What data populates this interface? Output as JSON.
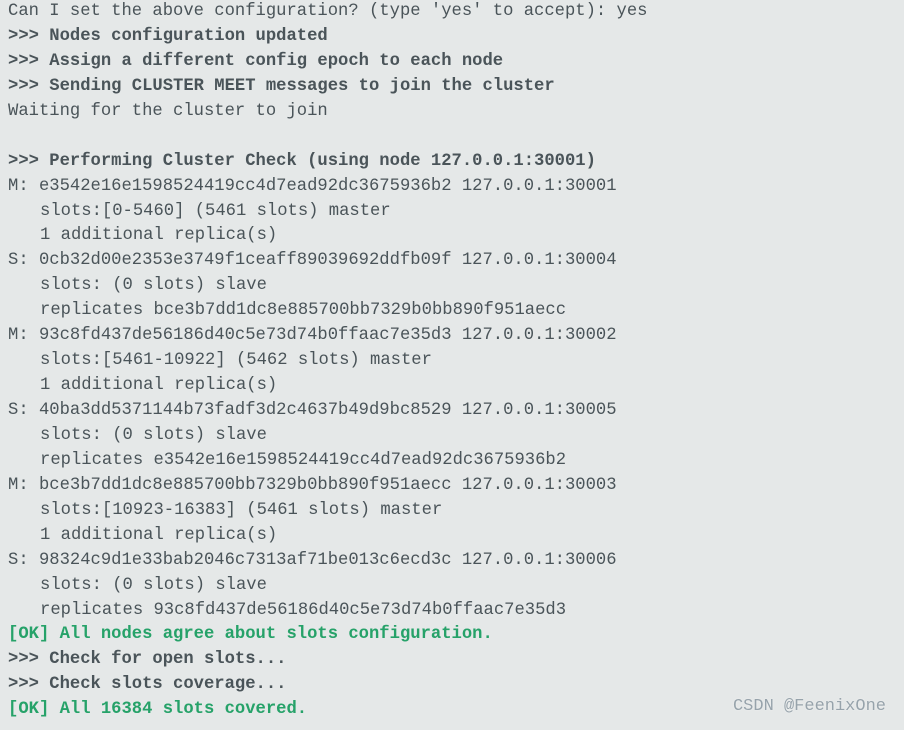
{
  "prompt": {
    "question": "Can I set the above configuration? (type 'yes' to accept): ",
    "answer": "yes"
  },
  "messages": {
    "nodes_updated": ">>> Nodes configuration updated",
    "assign_epoch": ">>> Assign a different config epoch to each node",
    "sending_meet": ">>> Sending CLUSTER MEET messages to join the cluster",
    "waiting": "Waiting for the cluster to join",
    "performing_check": ">>> Performing Cluster Check (using node 127.0.0.1:30001)",
    "ok_slots_config": "[OK] All nodes agree about slots configuration.",
    "check_open_slots": ">>> Check for open slots...",
    "check_coverage": ">>> Check slots coverage...",
    "ok_covered": "[OK] All 16384 slots covered."
  },
  "nodes": {
    "n1": {
      "line1": "M: e3542e16e1598524419cc4d7ead92dc3675936b2 127.0.0.1:30001",
      "line2": "slots:[0-5460] (5461 slots) master",
      "line3": "1 additional replica(s)"
    },
    "n2": {
      "line1": "S: 0cb32d00e2353e3749f1ceaff89039692ddfb09f 127.0.0.1:30004",
      "line2": "slots: (0 slots) slave",
      "line3": "replicates bce3b7dd1dc8e885700bb7329b0bb890f951aecc"
    },
    "n3": {
      "line1": "M: 93c8fd437de56186d40c5e73d74b0ffaac7e35d3 127.0.0.1:30002",
      "line2": "slots:[5461-10922] (5462 slots) master",
      "line3": "1 additional replica(s)"
    },
    "n4": {
      "line1": "S: 40ba3dd5371144b73fadf3d2c4637b49d9bc8529 127.0.0.1:30005",
      "line2": "slots: (0 slots) slave",
      "line3": "replicates e3542e16e1598524419cc4d7ead92dc3675936b2"
    },
    "n5": {
      "line1": "M: bce3b7dd1dc8e885700bb7329b0bb890f951aecc 127.0.0.1:30003",
      "line2": "slots:[10923-16383] (5461 slots) master",
      "line3": "1 additional replica(s)"
    },
    "n6": {
      "line1": "S: 98324c9d1e33bab2046c7313af71be013c6ecd3c 127.0.0.1:30006",
      "line2": "slots: (0 slots) slave",
      "line3": "replicates 93c8fd437de56186d40c5e73d74b0ffaac7e35d3"
    }
  },
  "watermark": "CSDN @FeenixOne"
}
